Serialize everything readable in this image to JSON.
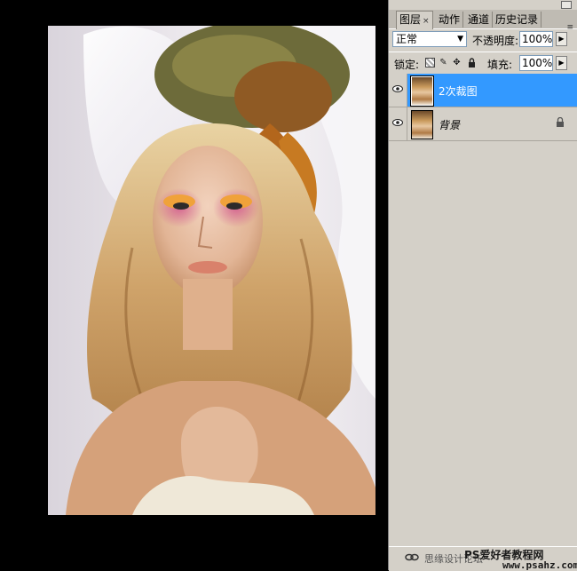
{
  "panel": {
    "tabs": [
      {
        "label": "图层",
        "active": true,
        "close": "×"
      },
      {
        "label": "动作",
        "active": false
      },
      {
        "label": "通道",
        "active": false
      },
      {
        "label": "历史记录",
        "active": false
      }
    ],
    "menu_icon": "≡"
  },
  "blend": {
    "mode": "正常",
    "opacity_label": "不透明度:",
    "opacity_value": "100%"
  },
  "lock": {
    "label": "锁定:",
    "icons": [
      "lock-transparent-icon",
      "lock-brush-icon",
      "lock-move-icon",
      "lock-all-icon"
    ],
    "fill_label": "填充:",
    "fill_value": "100%"
  },
  "layers": [
    {
      "name": "2次裁图",
      "selected": true,
      "visible": true,
      "locked": false
    },
    {
      "name": "背景",
      "selected": false,
      "visible": true,
      "locked": true,
      "italic": true
    }
  ],
  "watermark": {
    "site_cn": "PS爱好者教程网",
    "site_en": "www.psahz.com",
    "forum": "思缘设计论坛"
  },
  "colors": {
    "selected_row": "#3399ff",
    "panel_bg": "#d4d0c8",
    "canvas_bg": "#000000"
  }
}
